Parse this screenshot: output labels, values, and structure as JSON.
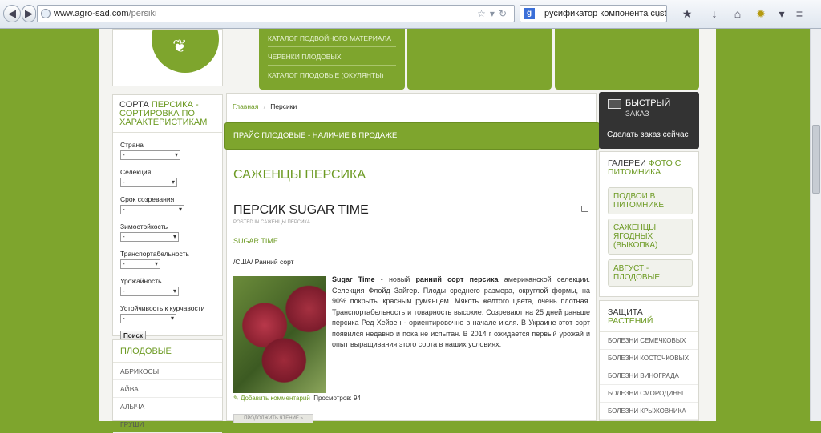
{
  "browser": {
    "url_host": "www.agro-sad.com",
    "url_path": "/persiki",
    "search_query": "русификатор компонента custom"
  },
  "top_menu": [
    "КАТАЛОГ ПОДВОЙНОГО МАТЕРИАЛА",
    "ЧЕРЕНКИ ПЛОДОВЫХ",
    "КАТАЛОГ ПЛОДОВЫЕ (ОКУЛЯНТЫ)"
  ],
  "filter": {
    "title_a": "СОРТА ",
    "title_b": "ПЕРСИКА - СОРТИРОВКА ПО ХАРАКТЕРИСТИКАМ",
    "fields": [
      {
        "label": "Страна",
        "value": "-"
      },
      {
        "label": "Селекция",
        "value": "-"
      },
      {
        "label": "Срок созревания",
        "value": "-"
      },
      {
        "label": "Зимостойкость",
        "value": "-"
      },
      {
        "label": "Транспортабельность",
        "value": "-"
      },
      {
        "label": "Урожайность",
        "value": "-"
      },
      {
        "label": "Устойчивость к курчавости",
        "value": "-"
      }
    ],
    "button": "Поиск"
  },
  "fruits": {
    "title": "ПЛОДОВЫЕ",
    "items": [
      "АБРИКОСЫ",
      "АЙВА",
      "АЛЫЧА",
      "ГРУШИ"
    ]
  },
  "breadcrumb": {
    "home": "Главная",
    "current": "Персики"
  },
  "price_bar": "ПРАЙС ПЛОДОВЫЕ - НАЛИЧИЕ В ПРОДАЖЕ",
  "article": {
    "category": "САЖЕНЦЫ ПЕРСИКА",
    "title": "ПЕРСИК SUGAR TIME",
    "posted": "POSTED IN САЖЕНЦЫ ПЕРСИКА",
    "subtitle": "SUGAR TIME",
    "country": "/США/ Ранний сорт",
    "name_bold": "Sugar Time",
    "text_1": " - новый ",
    "bold_2": "ранний сорт персика",
    "text_2": " американской селекции. Селекция Флойд Зайгер. Плоды среднего размера, округлой формы, на 90% покрыты красным румянцем. Мякоть желтого цвета, очень плотная. Транспортабельность и товарность высокие. Созревают на 25 дней раньше персика Ред Хейвен - ориентировочно в начале июля. В Украине этот сорт появился недавно и пока не испытан. В 2014 г ожидается первый урожай и опыт выращивания этого сорта в наших условиях.",
    "add_comment": "Добавить комментарий",
    "views": "Просмотров: 94",
    "read_more": "ПРОДОЛЖИТЬ ЧТЕНИЕ »"
  },
  "quick_order": {
    "title": "БЫСТРЫЙ",
    "subtitle": "ЗАКАЗ",
    "cta": "Сделать заказ сейчас"
  },
  "gallery": {
    "title_a": "ГАЛЕРЕИ ",
    "title_b": "ФОТО С ПИТОМНИКА",
    "items": [
      "ПОДВОИ В ПИТОМНИКЕ",
      "САЖЕНЦЫ ЯГОДНЫХ (ВЫКОПКА)",
      "АВГУСТ - ПЛОДОВЫЕ"
    ]
  },
  "protection": {
    "title_a": "ЗАЩИТА ",
    "title_b": "РАСТЕНИЙ",
    "items": [
      "БОЛЕЗНИ СЕМЕЧКОВЫХ",
      "БОЛЕЗНИ КОСТОЧКОВЫХ",
      "БОЛЕЗНИ ВИНОГРАДА",
      "БОЛЕЗНИ СМОРОДИНЫ",
      "БОЛЕЗНИ КРЫЖОВНИКА"
    ]
  },
  "colors": {
    "brand_green": "#7ea52d",
    "link_green": "#6c9a22",
    "dark_panel": "#333333"
  }
}
